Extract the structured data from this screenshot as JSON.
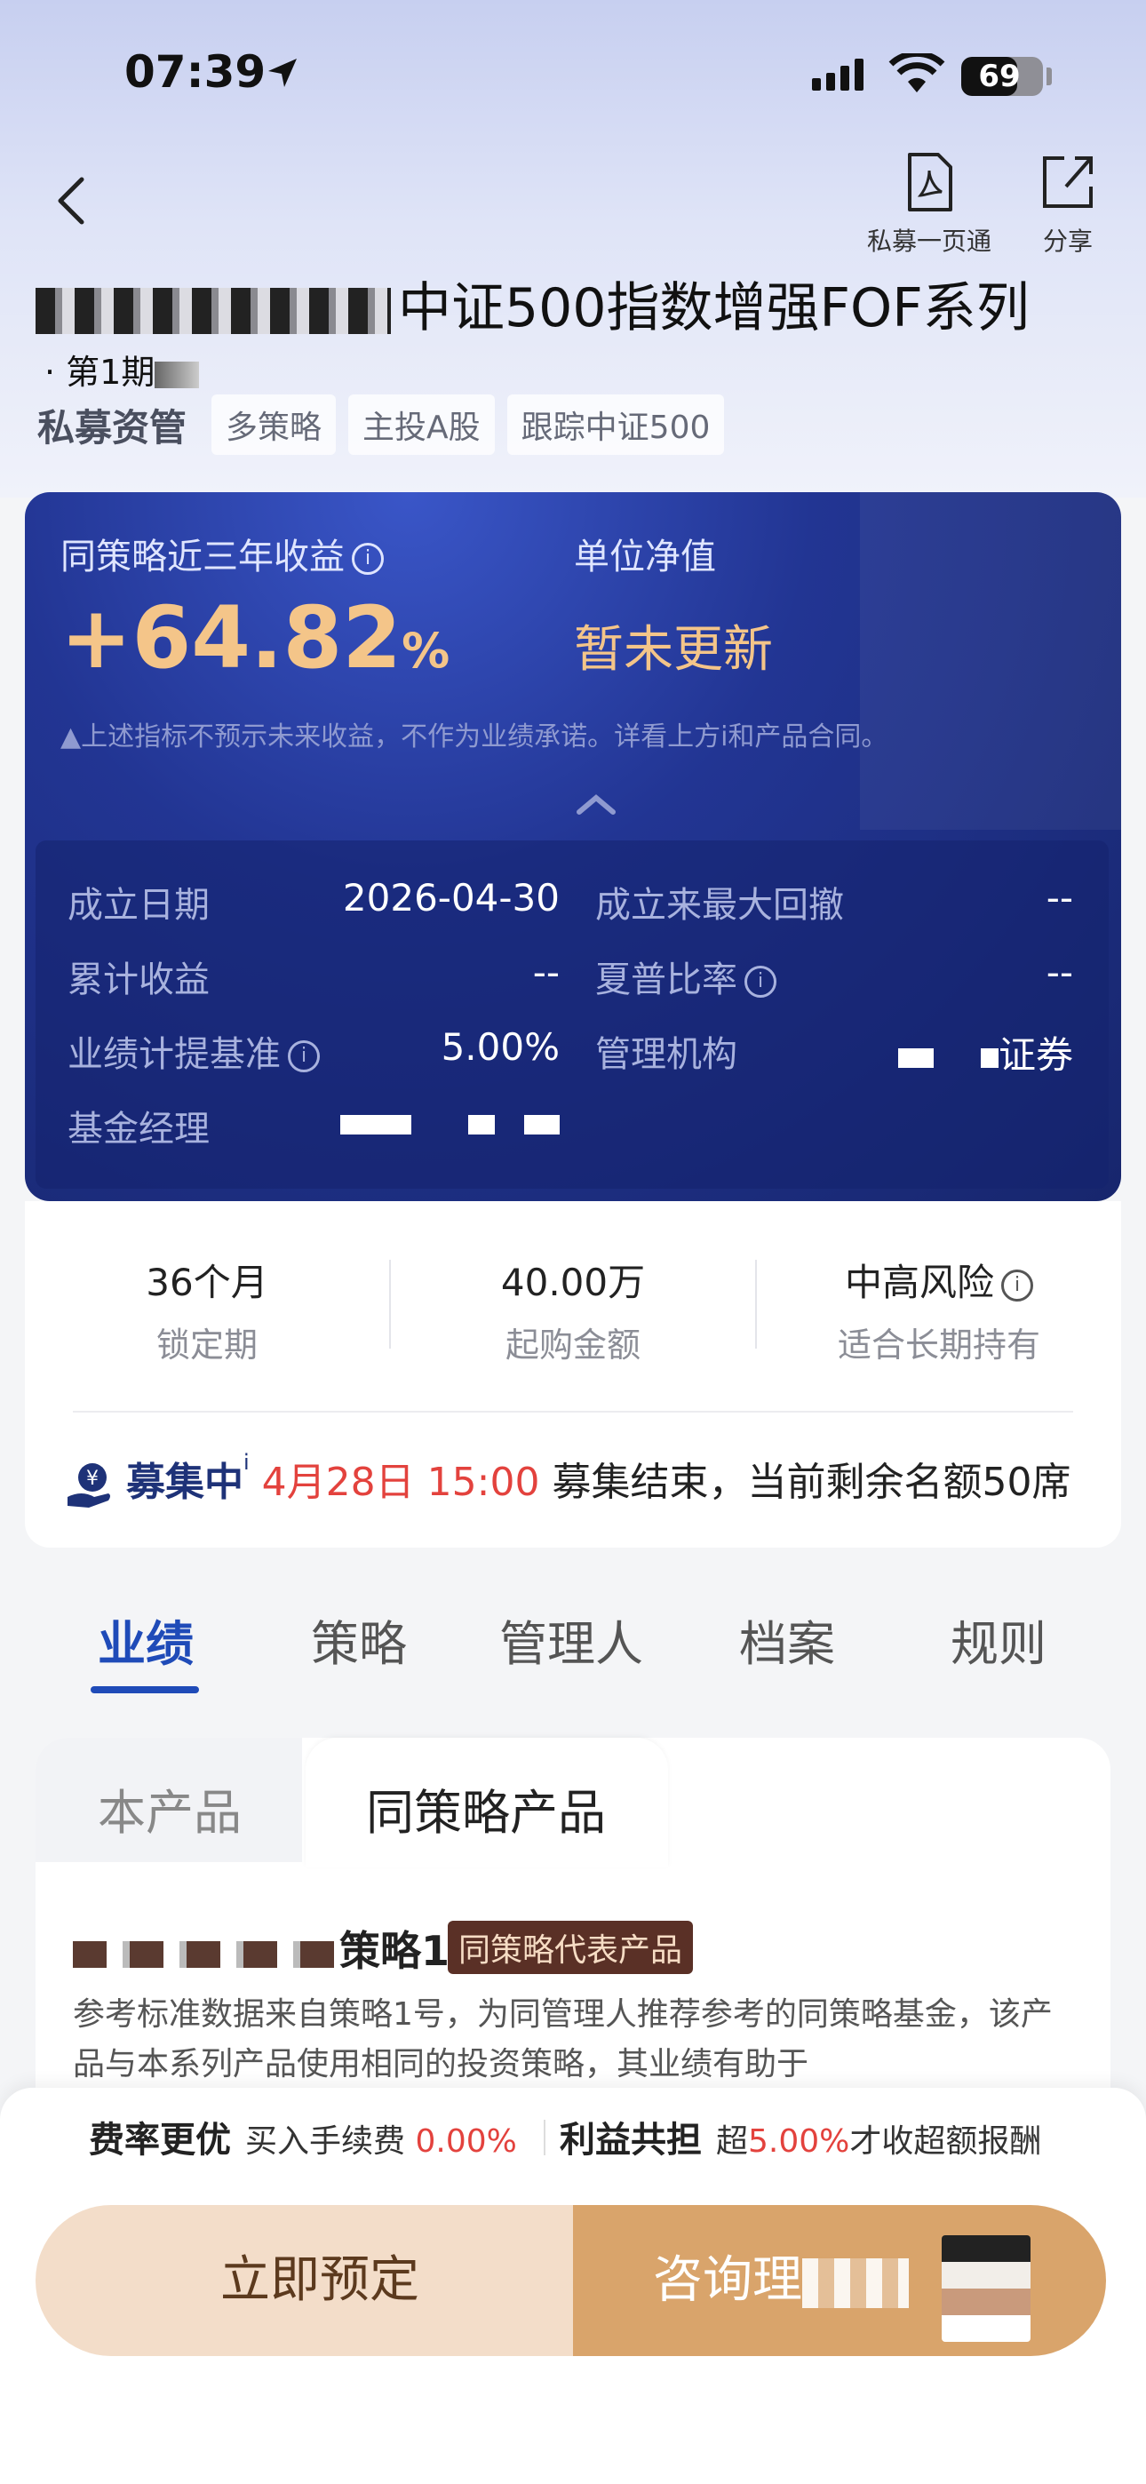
{
  "status_bar": {
    "time": "07:39",
    "battery": "69",
    "battery_level": 0.69
  },
  "nav": {
    "pdf_label": "私募一页通",
    "share_label": "分享"
  },
  "header": {
    "title": "中证500指数增强FOF系列",
    "subtitle": "· 第1期",
    "category": "私募资管",
    "tags": [
      "多策略",
      "主投A股",
      "跟踪中证500"
    ]
  },
  "hero": {
    "kpi1_label": "同策略近三年收益",
    "kpi1_value": "+64.82",
    "kpi1_unit": "%",
    "kpi2_label": "单位净值",
    "kpi2_value": "暂未更新",
    "disclaimer": "▲上述指标不预示未来收益，不作为业绩承诺。详看上方i和产品合同。"
  },
  "details": {
    "establish_label": "成立日期",
    "establish_value": "2026-04-30",
    "max_drawdown_label": "成立来最大回撤",
    "max_drawdown_value": "--",
    "cum_return_label": "累计收益",
    "cum_return_value": "--",
    "sharpe_label": "夏普比率",
    "sharpe_value": "--",
    "benchmark_label": "业绩计提基准",
    "benchmark_value": "5.00%",
    "manager_org_label": "管理机构",
    "manager_org_value": "证券",
    "fund_manager_label": "基金经理"
  },
  "stats": [
    {
      "value": "36个月",
      "label": "锁定期"
    },
    {
      "value": "40.00万",
      "label": "起购金额"
    },
    {
      "value": "中高风险",
      "label": "适合长期持有"
    }
  ],
  "notice": {
    "status": "募集中",
    "sup": "i",
    "deadline": "4月28日 15:00",
    "text": "募集结束，当前剩余名额50席"
  },
  "tabs": [
    "业绩",
    "策略",
    "管理人",
    "档案",
    "规则"
  ],
  "sub_tabs": [
    "本产品",
    "同策略产品"
  ],
  "product": {
    "name_suffix": "策略1号",
    "badge": "同策略代表产品",
    "description": "参考标准数据来自策略1号，为同管理人推荐参考的同策略基金，该产品与本系列产品使用相同的投资策略，其业绩有助于"
  },
  "benefits": {
    "fee_title": "费率更优",
    "fee_text": "买入手续费",
    "fee_value": "0.00%",
    "share_title": "利益共担",
    "share_prefix": "超",
    "share_value": "5.00%",
    "share_suffix": "才收超额报酬"
  },
  "actions": {
    "reserve": "立即预定",
    "consult": "咨询理"
  },
  "colors": {
    "accent_blue": "#1f4bb8",
    "gold": "#f4c589",
    "red": "#e3423d",
    "consult": "#d9a46b"
  }
}
